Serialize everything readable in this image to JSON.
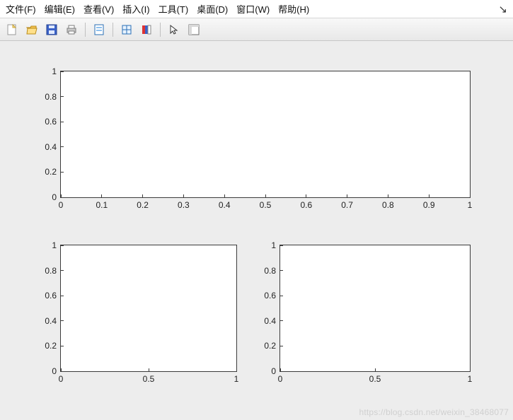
{
  "menubar": {
    "items": [
      {
        "label": "文件(F)"
      },
      {
        "label": "编辑(E)"
      },
      {
        "label": "查看(V)"
      },
      {
        "label": "插入(I)"
      },
      {
        "label": "工具(T)"
      },
      {
        "label": "桌面(D)"
      },
      {
        "label": "窗口(W)"
      },
      {
        "label": "帮助(H)"
      }
    ],
    "undock_glyph": "↘"
  },
  "toolbar": {
    "buttons": [
      {
        "name": "new-figure-icon"
      },
      {
        "name": "open-icon"
      },
      {
        "name": "save-icon"
      },
      {
        "name": "print-icon"
      },
      {
        "name": "SEP"
      },
      {
        "name": "page-setup-icon"
      },
      {
        "name": "SEP"
      },
      {
        "name": "data-cursor-icon"
      },
      {
        "name": "colorbar-icon"
      },
      {
        "name": "SEP"
      },
      {
        "name": "pointer-icon"
      },
      {
        "name": "plot-tools-icon"
      }
    ]
  },
  "chart_data": [
    {
      "type": "line",
      "title": "",
      "xlabel": "",
      "ylabel": "",
      "xlim": [
        0,
        1
      ],
      "ylim": [
        0,
        1
      ],
      "xticks": [
        "0",
        "0.1",
        "0.2",
        "0.3",
        "0.4",
        "0.5",
        "0.6",
        "0.7",
        "0.8",
        "0.9",
        "1"
      ],
      "yticks": [
        "0",
        "0.2",
        "0.4",
        "0.6",
        "0.8",
        "1"
      ],
      "series": []
    },
    {
      "type": "line",
      "title": "",
      "xlabel": "",
      "ylabel": "",
      "xlim": [
        0,
        1
      ],
      "ylim": [
        0,
        1
      ],
      "xticks": [
        "0",
        "0.5",
        "1"
      ],
      "yticks": [
        "0",
        "0.2",
        "0.4",
        "0.6",
        "0.8",
        "1"
      ],
      "series": []
    },
    {
      "type": "line",
      "title": "",
      "xlabel": "",
      "ylabel": "",
      "xlim": [
        0,
        1
      ],
      "ylim": [
        0,
        1
      ],
      "xticks": [
        "0",
        "0.5",
        "1"
      ],
      "yticks": [
        "0",
        "0.2",
        "0.4",
        "0.6",
        "0.8",
        "1"
      ],
      "series": []
    }
  ],
  "watermark": "https://blog.csdn.net/weixin_38468077"
}
